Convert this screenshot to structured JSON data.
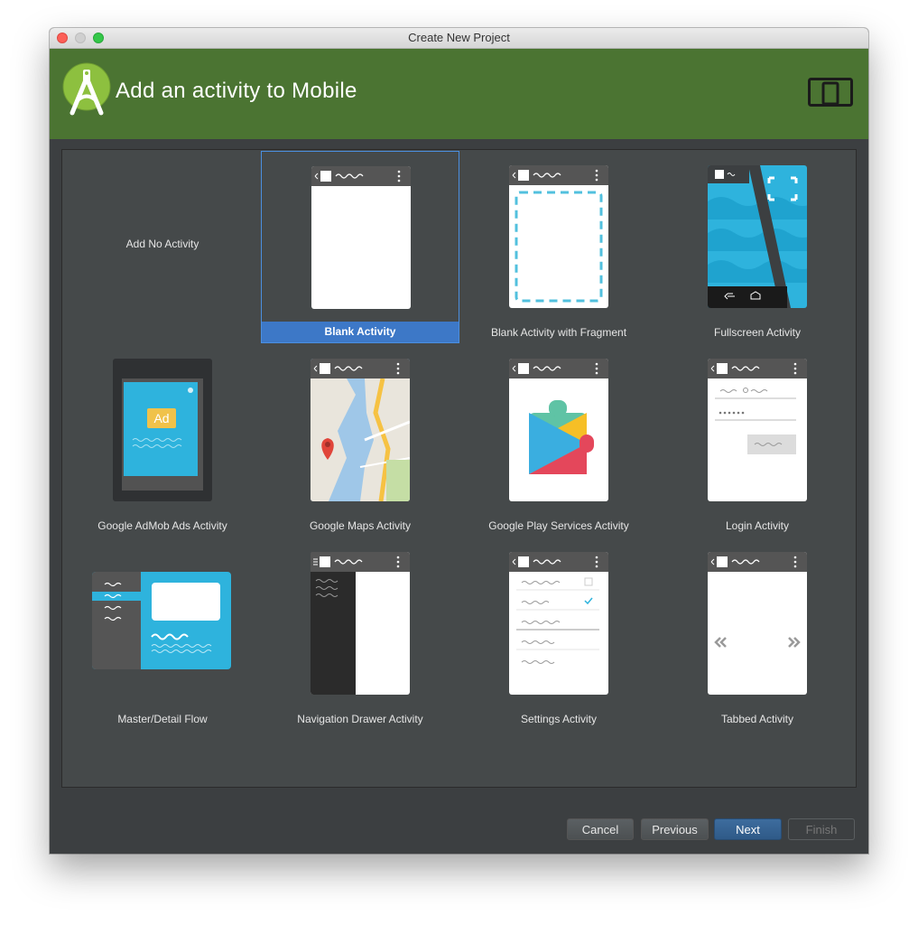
{
  "window": {
    "title": "Create New Project"
  },
  "header": {
    "title": "Add an activity to Mobile"
  },
  "activities": [
    {
      "label": "Add No Activity"
    },
    {
      "label": "Blank Activity",
      "selected": true
    },
    {
      "label": "Blank Activity with Fragment"
    },
    {
      "label": "Fullscreen Activity"
    },
    {
      "label": "Google AdMob Ads Activity",
      "badge": "Ad"
    },
    {
      "label": "Google Maps Activity"
    },
    {
      "label": "Google Play Services Activity"
    },
    {
      "label": "Login Activity"
    },
    {
      "label": "Master/Detail Flow"
    },
    {
      "label": "Navigation Drawer Activity"
    },
    {
      "label": "Settings Activity"
    },
    {
      "label": "Tabbed Activity"
    }
  ],
  "buttons": {
    "cancel": "Cancel",
    "previous": "Previous",
    "next": "Next",
    "finish": "Finish"
  },
  "colors": {
    "header": "#4b7432",
    "selection": "#3d78c7",
    "panel": "#45494a",
    "accent_blue": "#2eb3dd"
  }
}
